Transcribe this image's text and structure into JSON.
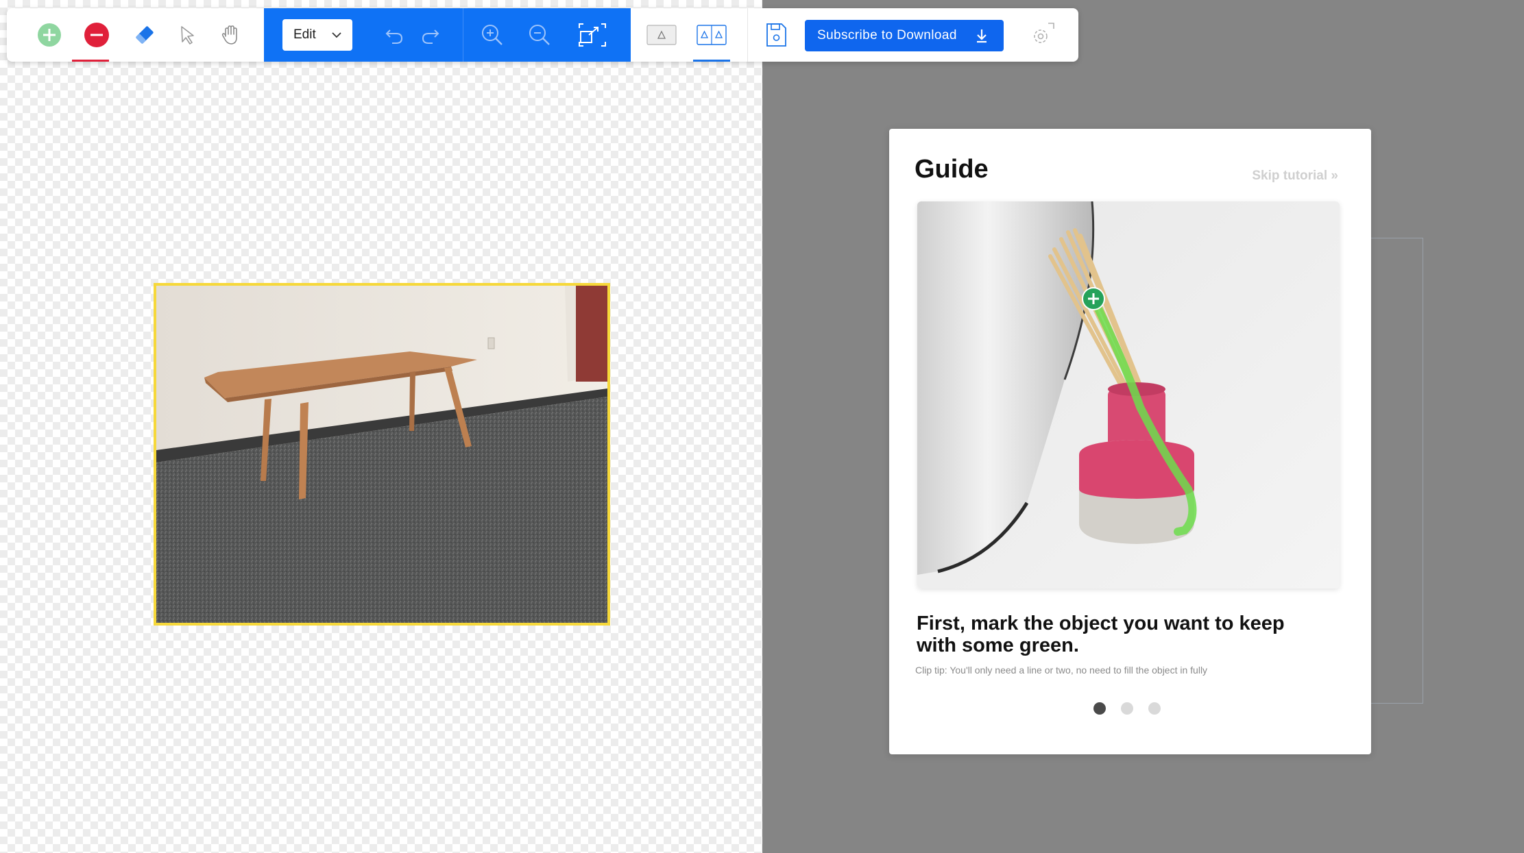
{
  "toolbar": {
    "tools": [
      {
        "name": "add-mark",
        "icon": "plus-circle-icon",
        "color": "#7bd08f"
      },
      {
        "name": "remove-mark",
        "icon": "minus-circle-icon",
        "color": "#e0203a",
        "selected": true
      },
      {
        "name": "eraser",
        "icon": "eraser-icon",
        "color": "#1a73e8"
      },
      {
        "name": "select",
        "icon": "cursor-arrow-icon"
      },
      {
        "name": "pan",
        "icon": "hand-icon"
      }
    ],
    "edit_select": "Edit",
    "view_modes": [
      {
        "name": "single-view",
        "icon": "single-triangle-icon"
      },
      {
        "name": "split-view",
        "icon": "double-triangle-icon",
        "selected": true
      }
    ],
    "subscribe_label": "Subscribe to Download",
    "accent": "#0f72f5"
  },
  "guide": {
    "title": "Guide",
    "skip_label": "Skip tutorial »",
    "heading": "First, mark the object you want to keep with some green.",
    "tip": "Clip tip: You'll only need a line or two, no need to fill the object in fully",
    "steps_total": 3,
    "active_step": 1
  }
}
